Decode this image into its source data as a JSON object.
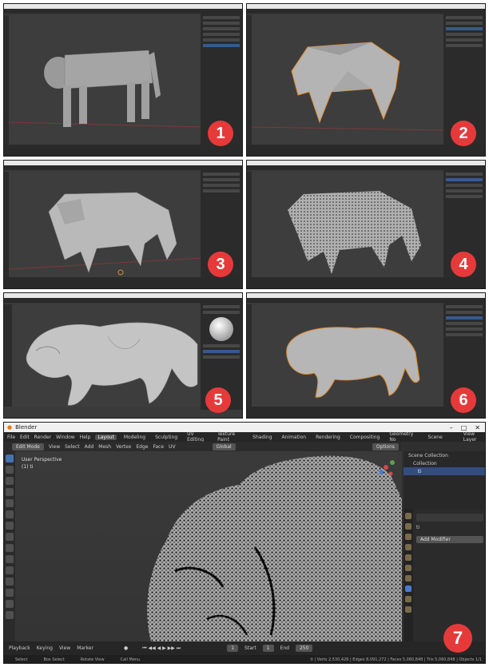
{
  "panels": [
    {
      "badge": "1"
    },
    {
      "badge": "2"
    },
    {
      "badge": "3"
    },
    {
      "badge": "4"
    },
    {
      "badge": "5"
    },
    {
      "badge": "6"
    }
  ],
  "main": {
    "badge": "7",
    "title": "Blender",
    "menus": [
      "File",
      "Edit",
      "Render",
      "Window",
      "Help"
    ],
    "workspaces": [
      "Layout",
      "Modeling",
      "Sculpting",
      "UV Editing",
      "Texture Paint",
      "Shading",
      "Animation",
      "Rendering",
      "Compositing",
      "Geometry No"
    ],
    "scene": "Scene",
    "view_layer": "View Layer",
    "mode": "Edit Mode",
    "header_menus": [
      "View",
      "Select",
      "Add",
      "Mesh",
      "Vertex",
      "Edge",
      "Face",
      "UV"
    ],
    "orientation": "Global",
    "options_label": "Options",
    "viewport_label": "User Perspective",
    "viewport_sub": "(1) ti",
    "outliner": {
      "scene_collection": "Scene Collection",
      "collection": "Collection",
      "object": "ti"
    },
    "props": {
      "object": "ti",
      "add_modifier": "Add Modifier"
    },
    "timeline": {
      "items": [
        "Playback",
        "Keying",
        "View",
        "Marker"
      ],
      "frame": "1",
      "start_label": "Start",
      "start": "1",
      "end_label": "End",
      "end": "250"
    },
    "status": {
      "select": "Select",
      "box_select": "Box Select",
      "rotate": "Rotate View",
      "menu": "Call Menu",
      "stats": "ti | Verts 2,530,426 | Edges 8,091,272 | Faces 5,060,848 | Tris 5,060,848 | Objects 1/1"
    }
  }
}
